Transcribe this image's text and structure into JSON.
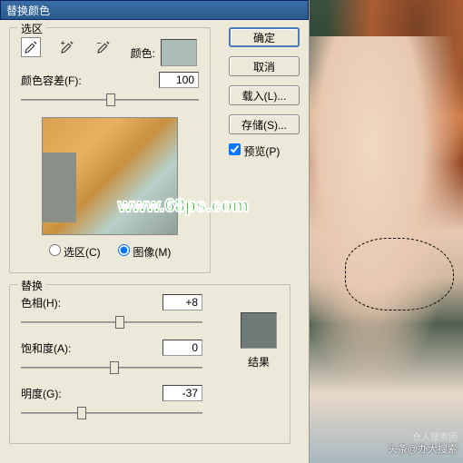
{
  "title": "替换颜色",
  "selection": {
    "legend": "选区",
    "color_label": "颜色:",
    "swatch_color": "#aabdb8",
    "fuzziness_label": "颜色容差(F):",
    "fuzziness_value": "100",
    "radio_selection": "选区(C)",
    "radio_image": "图像(M)"
  },
  "replace": {
    "legend": "替换",
    "hue_label": "色相(H):",
    "hue_value": "+8",
    "saturation_label": "饱和度(A):",
    "saturation_value": "0",
    "lightness_label": "明度(G):",
    "lightness_value": "-37",
    "result_label": "结果",
    "result_color": "#6e7a78"
  },
  "buttons": {
    "ok": "确定",
    "cancel": "取消",
    "load": "载入(L)...",
    "save": "存储(S)...",
    "preview": "预览(P)"
  },
  "watermark": "www.68ps.com",
  "wm_bottom": "头条@办大搜索",
  "wm_bottom2": "仓人搜索团"
}
